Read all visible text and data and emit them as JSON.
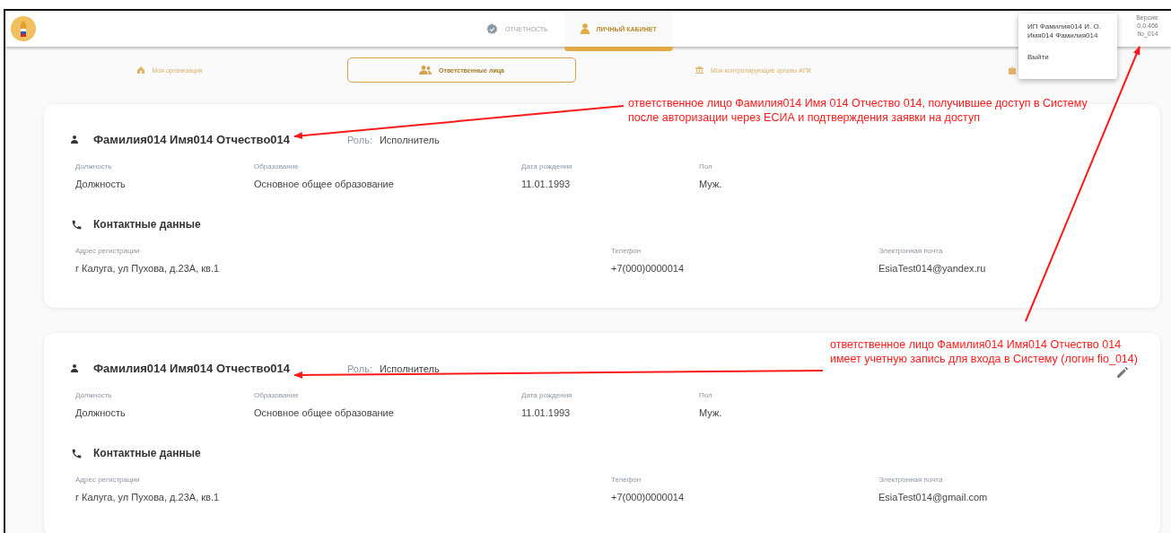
{
  "header": {
    "nav": [
      {
        "label": "ОТЧЕТНОСТЬ",
        "kind": "reports",
        "selected": false
      },
      {
        "label": "ЛИЧНЫЙ КАБИНЕТ",
        "kind": "cabinet",
        "selected": true
      }
    ],
    "version": [
      "Версия:",
      "0.0.466",
      "fio_014"
    ]
  },
  "user_menu": {
    "user": "ИП Фамилия014 И. О. Имя014 Фамилия014",
    "logout": "Выйти"
  },
  "tabs": [
    {
      "label": "Моя организация",
      "kind": "home",
      "selected": false
    },
    {
      "label": "Ответственные лица",
      "kind": "people",
      "selected": true
    },
    {
      "label": "Мои контролирующие органы АПК",
      "kind": "bank",
      "selected": false
    },
    {
      "kind": "case"
    }
  ],
  "persons": [
    {
      "name": "Фамилия014 Имя014 Отчество014",
      "role_label": "Роль:",
      "role": "Исполнитель",
      "editable": false,
      "fields": [
        {
          "label": "Должность",
          "value": "Должность"
        },
        {
          "label": "Образование",
          "value": "Основное общее образование"
        },
        {
          "label": "Дата рождения",
          "value": "11.01.1993"
        },
        {
          "label": "Пол",
          "value": "Муж."
        }
      ],
      "contacts_title": "Контактные данные",
      "contacts": [
        {
          "label": "Адрес регистрации",
          "value": "г Калуга, ул Пухова, д.23А, кв.1"
        },
        {
          "label": "Телефон",
          "value": "+7(000)0000014"
        },
        {
          "label": "Электронная почта",
          "value": "EsiaTest014@yandex.ru"
        }
      ]
    },
    {
      "name": "Фамилия014 Имя014 Отчество014",
      "role_label": "Роль:",
      "role": "Исполнитель",
      "editable": true,
      "fields": [
        {
          "label": "Должность",
          "value": "Должность"
        },
        {
          "label": "Образование",
          "value": "Основное общее образование"
        },
        {
          "label": "Дата рождения",
          "value": "11.01.1993"
        },
        {
          "label": "Пол",
          "value": "Муж."
        }
      ],
      "contacts_title": "Контактные данные",
      "contacts": [
        {
          "label": "Адрес регистрации",
          "value": "г Калуга, ул Пухова, д.23А, кв.1"
        },
        {
          "label": "Телефон",
          "value": "+7(000)0000014"
        },
        {
          "label": "Электронная почта",
          "value": "EsiaTest014@gmail.com"
        }
      ]
    }
  ],
  "annotations": [
    {
      "text": "ответственное лицо Фамилия014 Имя 014 Отчество 014, получившее доступ в Систему после авторизации через ЕСИА и подтверждения заявки на доступ"
    },
    {
      "text": "ответственное лицо Фамилия014 Имя014 Отчество 014 имеет учетную запись для входа в Систему (логин fio_014)"
    }
  ]
}
